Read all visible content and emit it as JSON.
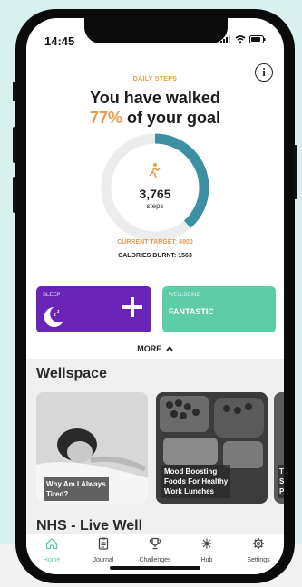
{
  "status_bar": {
    "time": "14:45"
  },
  "steps": {
    "section_label": "DAILY STEPS",
    "headline_prefix": "You have walked",
    "percent_text": "77%",
    "headline_suffix": "of your goal",
    "progress": 0.77,
    "count": "3,765",
    "count_label": "steps",
    "current_target": "CURRENT TARGET: 4900",
    "calories": "CALORIES BURNT: 1563",
    "colors": {
      "accent": "#e89a4b",
      "ring": "#3d8fa3",
      "track": "#ececec"
    }
  },
  "cards": {
    "sleep": {
      "label": "SLEEP",
      "color": "#6a23b7",
      "icon": "moon-icon",
      "action_icon": "plus-icon"
    },
    "wellbeing": {
      "label": "WELLBEING",
      "value": "FANTASTIC",
      "color": "#5ecca7"
    }
  },
  "more": {
    "label": "MORE"
  },
  "wellspace": {
    "title": "Wellspace",
    "tiles": [
      {
        "caption_line1": "Why Am I Always",
        "caption_line2": "Tired?"
      },
      {
        "caption_line1": "Mood Boosting",
        "caption_line2": "Foods For Healthy",
        "caption_line3": "Work Lunches"
      },
      {
        "caption_line1": "T",
        "caption_line2": "S",
        "caption_line3": "P"
      }
    ]
  },
  "nhs": {
    "title": "NHS - Live Well"
  },
  "nav": {
    "items": [
      {
        "label": "Home",
        "icon": "home-icon"
      },
      {
        "label": "Journal",
        "icon": "journal-icon"
      },
      {
        "label": "Challenges",
        "icon": "trophy-icon"
      },
      {
        "label": "Hub",
        "icon": "hub-icon"
      },
      {
        "label": "Settings",
        "icon": "gear-icon"
      }
    ]
  }
}
